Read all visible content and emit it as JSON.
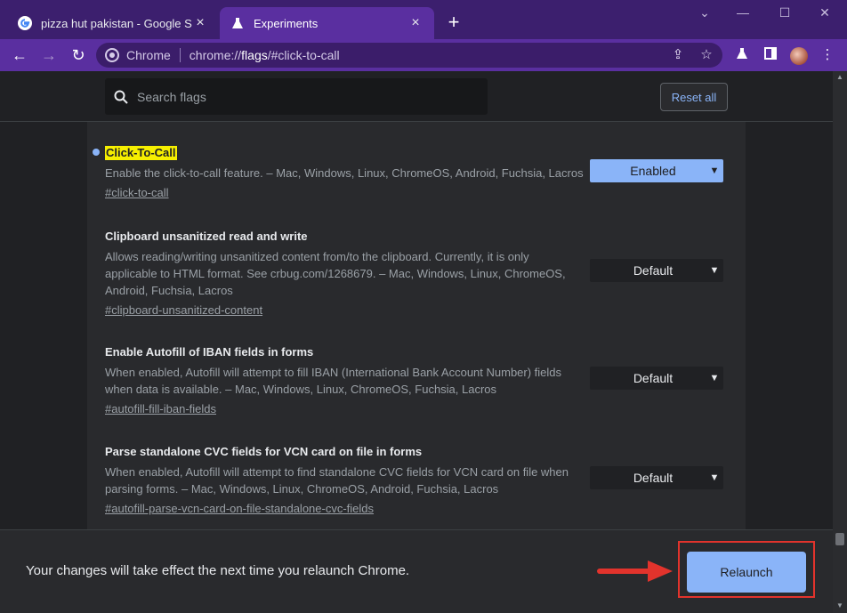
{
  "tabs": [
    {
      "title": "pizza hut pakistan - Google Searc",
      "icon": "google-icon",
      "active": false
    },
    {
      "title": "Experiments",
      "icon": "flask-icon",
      "active": true
    }
  ],
  "new_tab_symbol": "+",
  "omnibox": {
    "chip_label": "Chrome",
    "url_prefix": "chrome://",
    "url_host": "flags",
    "url_suffix": "/#click-to-call"
  },
  "search": {
    "placeholder": "Search flags"
  },
  "reset_all_label": "Reset all",
  "flags": [
    {
      "name": "Click-To-Call",
      "description": "Enable the click-to-call feature. – Mac, Windows, Linux, ChromeOS, Android, Fuchsia, Lacros",
      "link": "#click-to-call",
      "value": "Enabled",
      "highlighted": true,
      "modified": true
    },
    {
      "name": "Clipboard unsanitized read and write",
      "description": "Allows reading/writing unsanitized content from/to the clipboard. Currently, it is only applicable to HTML format. See crbug.com/1268679. – Mac, Windows, Linux, ChromeOS, Android, Fuchsia, Lacros",
      "link": "#clipboard-unsanitized-content",
      "value": "Default"
    },
    {
      "name": "Enable Autofill of IBAN fields in forms",
      "description": "When enabled, Autofill will attempt to fill IBAN (International Bank Account Number) fields when data is available. – Mac, Windows, Linux, ChromeOS, Fuchsia, Lacros",
      "link": "#autofill-fill-iban-fields",
      "value": "Default"
    },
    {
      "name": "Parse standalone CVC fields for VCN card on file in forms",
      "description": "When enabled, Autofill will attempt to find standalone CVC fields for VCN card on file when parsing forms. – Mac, Windows, Linux, ChromeOS, Android, Fuchsia, Lacros",
      "link": "#autofill-parse-vcn-card-on-file-standalone-cvc-fields",
      "value": "Default"
    }
  ],
  "relaunch": {
    "message": "Your changes will take effect the next time you relaunch Chrome.",
    "button_label": "Relaunch"
  },
  "colors": {
    "frame": "#3c1f6e",
    "toolbar": "#5a2fa0",
    "accent": "#8ab4f8",
    "highlight": "#f6ef00",
    "annotation_red": "#e2332c"
  }
}
